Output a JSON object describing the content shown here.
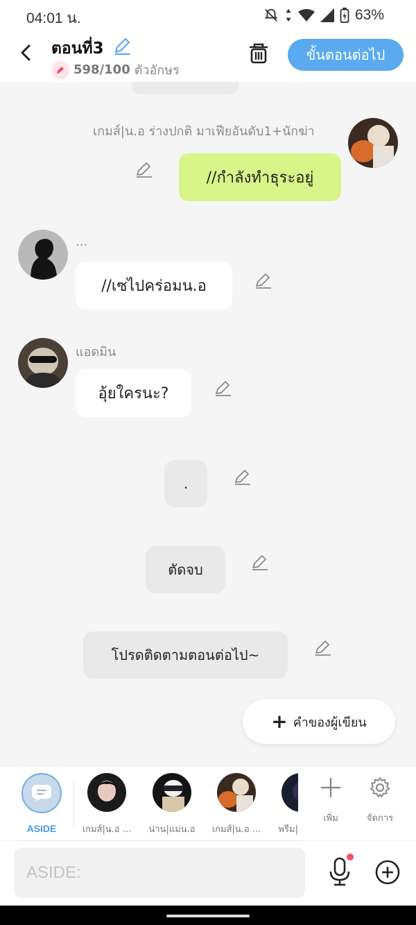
{
  "status": {
    "time": "04:01 น.",
    "battery": "63%"
  },
  "header": {
    "title": "ตอนที่3",
    "char_count": "598/100",
    "char_unit": "ตัวอักษร",
    "next_label": "ขั้นตอนต่อไป"
  },
  "messages": [
    {
      "sender": "เกมส์|น.อ ร่างปกติ มาเฟียอันดับ1+นักฆ่า",
      "text": "//กำลังทำธุระอยู่"
    },
    {
      "sender": "...",
      "text": "//เซไปคร่อมน.อ"
    },
    {
      "sender": "แอดมิน",
      "text": "อุ้ยใครนะ?"
    },
    {
      "text": "."
    },
    {
      "text": "ตัดจบ"
    },
    {
      "text": "โปรดติดตามตอนต่อไป~"
    }
  ],
  "author_note_label": "คำของผู้เขียน",
  "characters": [
    {
      "label": "ASIDE"
    },
    {
      "label": "เกมส์|น.อ ..."
    },
    {
      "label": "น่าน|แม่น.อ"
    },
    {
      "label": "เกมส์|น.อ ..."
    },
    {
      "label": "พรีม|"
    }
  ],
  "tools": {
    "add_label": "เพิ่ม",
    "manage_label": "จัดการ"
  },
  "input": {
    "placeholder": "ASIDE:"
  },
  "colors": {
    "accent": "#5aaaf0",
    "green_bubble": "#d8f58a",
    "mic_dot": "#f0506e"
  }
}
